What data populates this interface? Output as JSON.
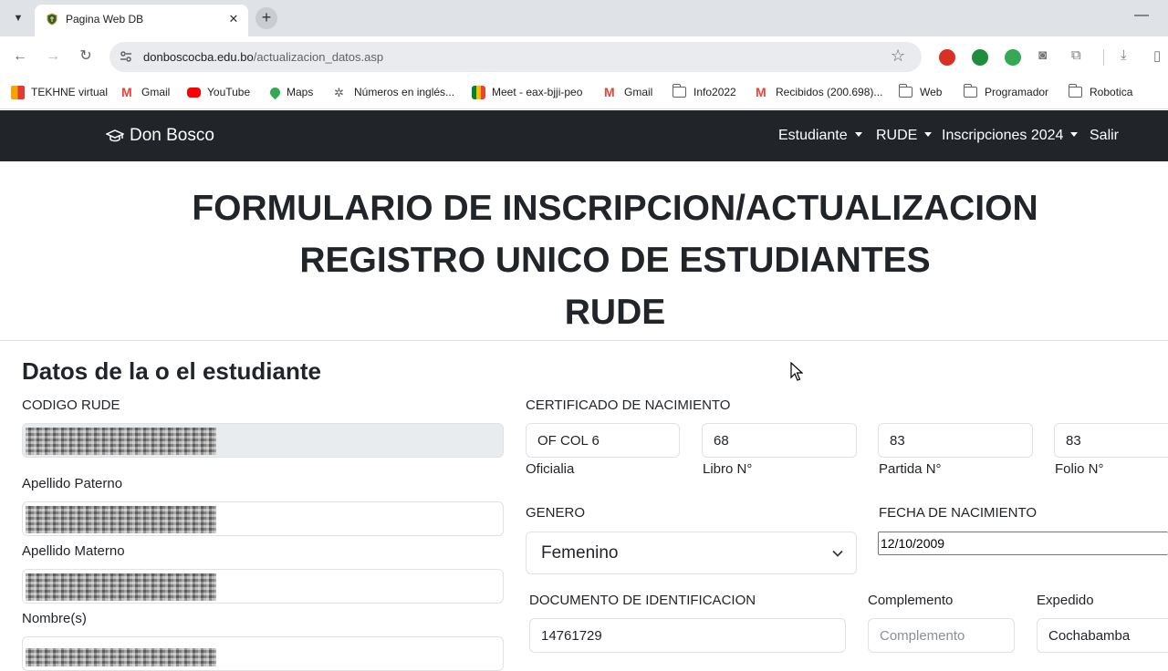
{
  "browser": {
    "tab_title": "Pagina Web DB",
    "new_tab_symbol": "+",
    "url_domain": "donboscocba.edu.bo",
    "url_path": "/actualizacion_datos.asp",
    "bookmarks": [
      {
        "label": "TEKHNE virtual",
        "icon": "tekhne-icon"
      },
      {
        "label": "Gmail",
        "icon": "gmail-icon"
      },
      {
        "label": "YouTube",
        "icon": "youtube-icon"
      },
      {
        "label": "Maps",
        "icon": "maps-icon"
      },
      {
        "label": "Números en inglés...",
        "icon": "puzzle-icon"
      },
      {
        "label": "Meet - eax-bjji-peo",
        "icon": "meet-icon"
      },
      {
        "label": "Gmail",
        "icon": "gmail-icon"
      },
      {
        "label": "Info2022",
        "icon": "folder-icon"
      },
      {
        "label": "Recibidos (200.698)...",
        "icon": "gmail-icon"
      },
      {
        "label": "Web",
        "icon": "folder-icon"
      },
      {
        "label": "Programador",
        "icon": "folder-icon"
      },
      {
        "label": "Robotica",
        "icon": "folder-icon"
      }
    ]
  },
  "navbar": {
    "brand": "Don Bosco",
    "items": [
      {
        "label": "Estudiante"
      },
      {
        "label": "RUDE"
      },
      {
        "label": "Inscripciones 2024"
      },
      {
        "label": "Salir"
      }
    ]
  },
  "header": {
    "line1": "FORMULARIO DE INSCRIPCION/ACTUALIZACION",
    "line2": "REGISTRO UNICO DE ESTUDIANTES",
    "line3": "RUDE"
  },
  "form": {
    "section_title": "Datos de la o el estudiante",
    "codigo_rude_label": "CODIGO RUDE",
    "apellido_paterno_label": "Apellido Paterno",
    "apellido_materno_label": "Apellido Materno",
    "nombres_label": "Nombre(s)",
    "certificado_label": "CERTIFICADO DE NACIMIENTO",
    "oficialia_value": "OF COL 6",
    "oficialia_label": "Oficialia",
    "libro_value": "68",
    "libro_label": "Libro N°",
    "partida_value": "83",
    "partida_label": "Partida N°",
    "folio_value": "83",
    "folio_label": "Folio N°",
    "genero_label": "GENERO",
    "genero_value": "Femenino",
    "fecha_label": "FECHA DE NACIMIENTO",
    "fecha_value": "12/10/2009",
    "documento_label": "DOCUMENTO DE IDENTIFICACION",
    "documento_value": "14761729",
    "complemento_label": "Complemento",
    "complemento_placeholder": "Complemento",
    "expedido_label": "Expedido",
    "expedido_value": "Cochabamba"
  }
}
